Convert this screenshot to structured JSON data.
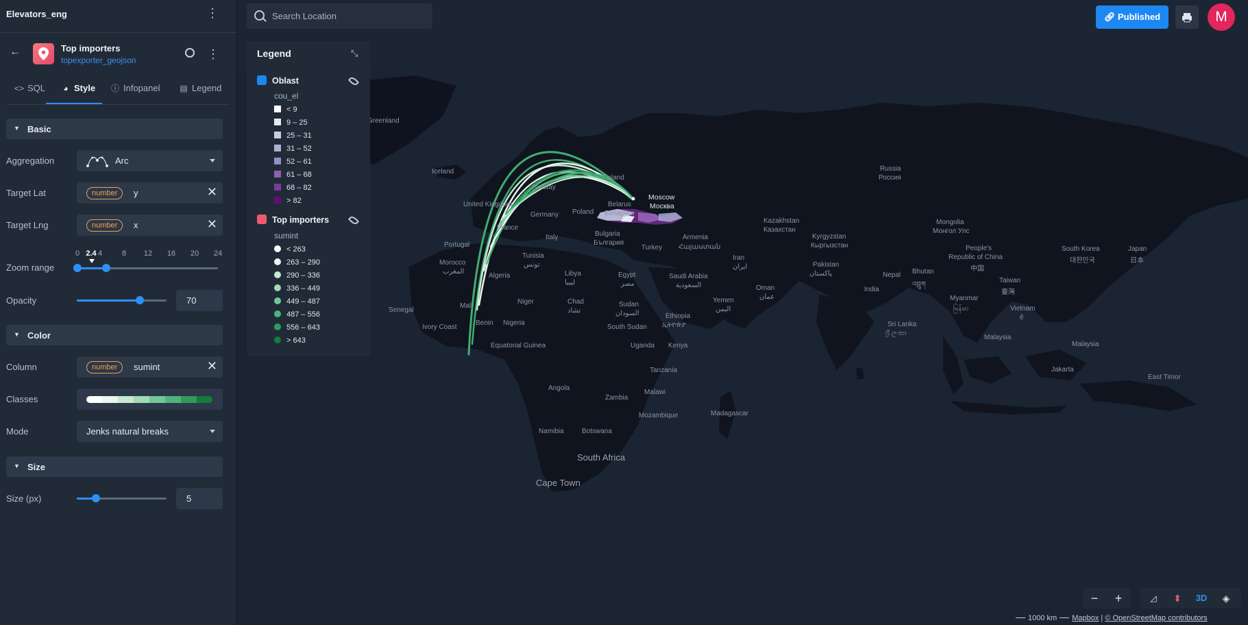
{
  "project": {
    "title": "Elevators_eng"
  },
  "layer": {
    "name": "Top importers",
    "source": "topexporter_geojson"
  },
  "tabs": [
    {
      "label": "SQL",
      "icon": "code-icon"
    },
    {
      "label": "Style",
      "icon": "palette-icon"
    },
    {
      "label": "Infopanel",
      "icon": "info-icon"
    },
    {
      "label": "Legend",
      "icon": "comment-icon"
    }
  ],
  "style": {
    "basic": {
      "title": "Basic",
      "aggregation_label": "Aggregation",
      "aggregation_value": "Arc",
      "target_lat_label": "Target Lat",
      "target_lat_type": "number",
      "target_lat_value": "y",
      "target_lng_label": "Target Lng",
      "target_lng_type": "number",
      "target_lng_value": "x",
      "zoom_range_label": "Zoom range",
      "zoom_ticks": [
        "0",
        "4",
        "8",
        "12",
        "16",
        "20",
        "24"
      ],
      "zoom_current": "2.4",
      "zoom_min": 0,
      "zoom_max": 5,
      "opacity_label": "Opacity",
      "opacity_value": "70"
    },
    "color": {
      "title": "Color",
      "column_label": "Column",
      "column_type": "number",
      "column_value": "sumint",
      "classes_label": "Classes",
      "classes_colors": [
        "#ffffff",
        "#e9f7ec",
        "#c5ead0",
        "#a0dcb5",
        "#74c69a",
        "#4eb47d",
        "#2f9a5c",
        "#157b3e"
      ],
      "mode_label": "Mode",
      "mode_value": "Jenks natural breaks"
    },
    "size": {
      "title": "Size",
      "size_label": "Size (px)",
      "size_value": "5"
    }
  },
  "search": {
    "placeholder": "Search Location"
  },
  "header": {
    "published_label": "Published",
    "avatar_letter": "M"
  },
  "legend": {
    "title": "Legend",
    "layers": [
      {
        "name": "Oblast",
        "field": "cou_el",
        "icon_color": "#1e88f2",
        "items": [
          {
            "label": "< 9",
            "color": "#ffffff"
          },
          {
            "label": "9 – 25",
            "color": "#e6eaf4"
          },
          {
            "label": "25 – 31",
            "color": "#c6cfe6"
          },
          {
            "label": "31 – 52",
            "color": "#aab3d6"
          },
          {
            "label": "52 – 61",
            "color": "#948fc6"
          },
          {
            "label": "61 – 68",
            "color": "#8b62b3"
          },
          {
            "label": "68 – 82",
            "color": "#7d3a9c"
          },
          {
            "label": "> 82",
            "color": "#650c7a"
          }
        ]
      },
      {
        "name": "Top importers",
        "field": "sumint",
        "icon_color": "#ef5a6f",
        "items": [
          {
            "label": "< 263",
            "color": "#ffffff"
          },
          {
            "label": "263 – 290",
            "color": "#e9f7ec"
          },
          {
            "label": "290 – 336",
            "color": "#c5ead0"
          },
          {
            "label": "336 – 449",
            "color": "#a0dcb5"
          },
          {
            "label": "449 – 487",
            "color": "#74c69a"
          },
          {
            "label": "487 – 556",
            "color": "#4eb47d"
          },
          {
            "label": "556 – 643",
            "color": "#2f9a5c"
          },
          {
            "label": "> 643",
            "color": "#157b3e"
          }
        ]
      }
    ]
  },
  "map": {
    "labels": {
      "greenland": "Greenland",
      "iceland": "Iceland",
      "norway": "Norway",
      "finland": "Finland",
      "russia": "Russia",
      "russia_local": "Россия",
      "moscow": "Moscow",
      "moscow_local": "Москва",
      "united_kingdom": "United Kingdom",
      "germany": "Germany",
      "poland": "Poland",
      "belarus": "Belarus",
      "belarus_local": "Беларусь",
      "portugal": "Portugal",
      "france": "France",
      "italy": "Italy",
      "bulgaria": "Bulgaria",
      "bulgaria_local": "България",
      "turkey": "Turkey",
      "armenia": "Armenia",
      "armenia_local": "Հայաստան",
      "kazakhstan": "Kazakhstan",
      "kazakhstan_local": "Казахстан",
      "kyrgyzstan": "Kyrgyzstan",
      "kyrgyzstan_local": "Кыргызстан",
      "mongolia": "Mongolia",
      "mongolia_local": "Монгол Улс",
      "china": "People's",
      "china2": "Republic of China",
      "china_local": "中国",
      "south_korea": "South Korea",
      "south_korea_local": "대한민국",
      "japan": "Japan",
      "japan_local": "日本",
      "morocco": "Morocco",
      "morocco_local": "المغرب",
      "tunisia": "Tunisia",
      "tunisia_local": "تونس",
      "algeria": "Algeria",
      "libya": "Libya",
      "libya_local": "ليبيا",
      "egypt": "Egypt",
      "egypt_local": "مصر",
      "saudi": "Saudi Arabia",
      "saudi_local": "السعودية",
      "iran": "Iran",
      "iran_local": "ایران",
      "pakistan": "Pakistan",
      "pakistan_local": "پاکستان",
      "nepal": "Nepal",
      "bhutan": "Bhutan",
      "bhutan_local": "འབྲུག",
      "india": "India",
      "taiwan": "Taiwan",
      "taiwan_local": "臺灣",
      "oman": "Oman",
      "oman_local": "عمان",
      "yemen": "Yemen",
      "yemen_local": "اليمن",
      "myanmar": "Myanmar",
      "myanmar_local": "မြန်မာ",
      "vietnam": "Vietnam",
      "vietnam_local": "ê",
      "senegal": "Senegal",
      "mali": "Mali",
      "niger": "Niger",
      "chad": "Chad",
      "chad_local": "تشاد",
      "sudan": "Sudan",
      "sudan_local": "السودان",
      "south_sudan": "South Sudan",
      "ethiopia": "Ethiopia",
      "ethiopia_local": "ኢትዮጵያ",
      "ivory_coast": "Ivory Coast",
      "benin": "Benin",
      "nigeria": "Nigeria",
      "eq_guinea": "Equatorial Guinea",
      "uganda": "Uganda",
      "kenya": "Kenya",
      "tanzania": "Tanzania",
      "angola": "Angola",
      "zambia": "Zambia",
      "malawi": "Malawi",
      "mozambique": "Mozambique",
      "madagascar": "Madagascar",
      "namibia": "Namibia",
      "botswana": "Botswana",
      "south_africa": "South Africa",
      "cape_town": "Cape Town",
      "sri_lanka": "Sri Lanka",
      "sri_lanka_local": "ශ්‍රී ලංකා",
      "malaysia": "Malaysia",
      "malaysia2": "Malaysia",
      "jakarta": "Jakarta",
      "east_timor": "East Timor"
    },
    "scale_label": "1000 km",
    "attribution_mapbox": "Mapbox",
    "attribution_osm": "© OpenStreetMap contributors",
    "mode_3d_label": "3D"
  },
  "colors": {
    "accent": "#1e88f2",
    "avatar": "#e3265b",
    "chip": "#f0a24e",
    "arc": "#3fb57a"
  }
}
